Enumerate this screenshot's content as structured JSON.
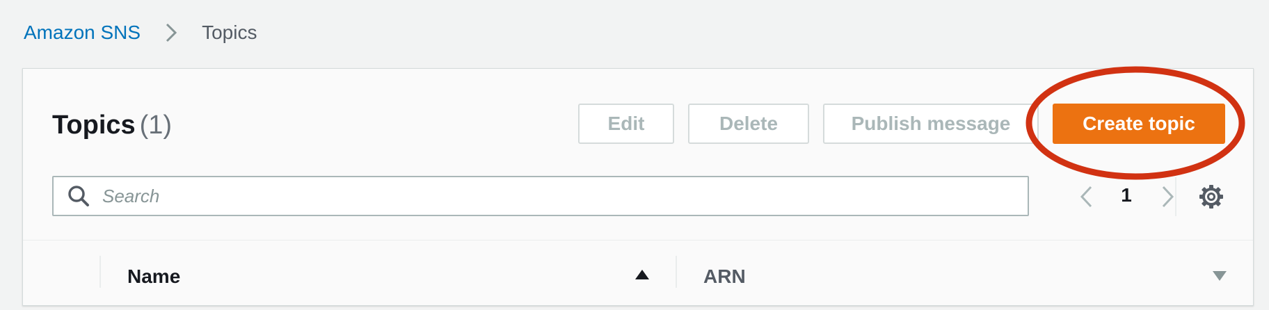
{
  "breadcrumb": {
    "root": "Amazon SNS",
    "current": "Topics",
    "separator_icon": "chevron-right-icon"
  },
  "header": {
    "title": "Topics",
    "count": "(1)"
  },
  "actions": {
    "edit_label": "Edit",
    "delete_label": "Delete",
    "publish_label": "Publish message",
    "create_label": "Create topic"
  },
  "search": {
    "placeholder": "Search",
    "value": "",
    "icon": "search-icon"
  },
  "pagination": {
    "current_page": "1",
    "prev_icon": "chevron-left-icon",
    "next_icon": "chevron-right-icon"
  },
  "settings": {
    "icon": "gear-icon"
  },
  "table": {
    "columns": [
      "Name",
      "ARN"
    ],
    "sort": {
      "column": "Name",
      "direction": "ascending"
    }
  },
  "annotation": {
    "shape": "ellipse",
    "color": "#d13212",
    "target": "Create topic"
  },
  "colors": {
    "accent": "#ec7211",
    "link": "#0073bb",
    "background": "#f2f3f3",
    "disabled_text": "#aab7b8"
  }
}
